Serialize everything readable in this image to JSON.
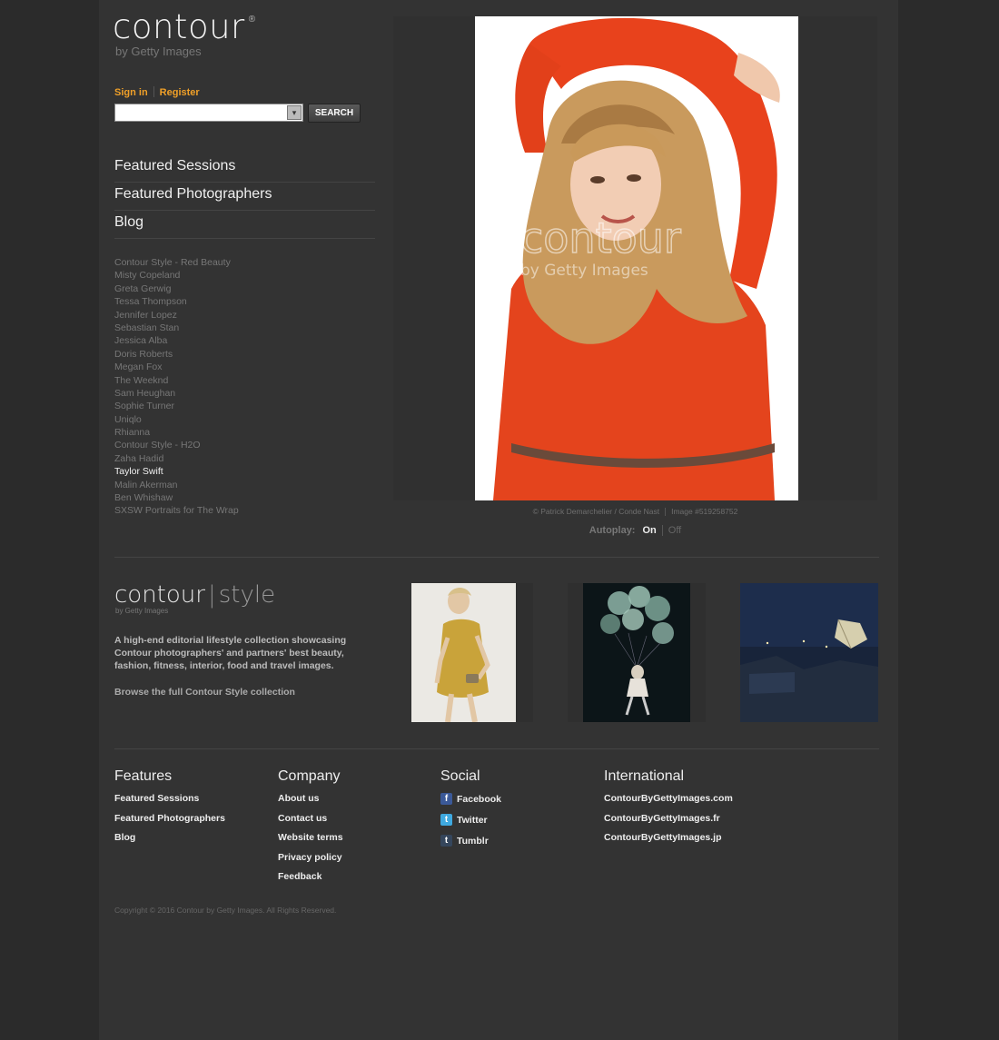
{
  "colors": {
    "accent": "#f0a028",
    "page_bg": "#333333",
    "outer_bg": "#2b2b2b"
  },
  "header": {
    "logo_word": "contour",
    "logo_reg": "®",
    "logo_by": "by Getty Images",
    "sign_in": "Sign in",
    "register": "Register",
    "search_value": "",
    "search_button": "SEARCH"
  },
  "nav": [
    "Featured Sessions",
    "Featured Photographers",
    "Blog"
  ],
  "sessions": [
    "Contour Style - Red Beauty",
    "Misty Copeland",
    "Greta Gerwig",
    "Tessa Thompson",
    "Jennifer Lopez",
    "Sebastian Stan",
    "Jessica Alba",
    "Doris Roberts",
    "Megan Fox",
    "The Weeknd",
    "Sam Heughan",
    "Sophie Turner",
    "Uniqlo",
    "Rhianna",
    "Contour Style - H2O",
    "Zaha Hadid",
    "Taylor Swift",
    "Malin Akerman",
    "Ben Whishaw",
    "SXSW Portraits for The Wrap"
  ],
  "active_session": "Taylor Swift",
  "hero": {
    "watermark_word": "contour",
    "watermark_by": "by Getty Images",
    "credit": "© Patrick Demarchelier / Conde Nast",
    "image_id": "Image #519258752",
    "autoplay_label": "Autoplay:",
    "autoplay_on": "On",
    "autoplay_off": "Off"
  },
  "contour_style": {
    "logo_a": "contour",
    "logo_b": "style",
    "logo_by": "by Getty Images",
    "description": "A high-end editorial lifestyle collection showcasing Contour photographers' and partners' best beauty, fashion, fitness, interior, food and travel images.",
    "browse_link": "Browse the full Contour Style collection"
  },
  "footer": {
    "features": {
      "title": "Features",
      "links": [
        "Featured Sessions",
        "Featured Photographers",
        "Blog"
      ]
    },
    "company": {
      "title": "Company",
      "links": [
        "About us",
        "Contact us",
        "Website terms",
        "Privacy policy",
        "Feedback"
      ]
    },
    "social": {
      "title": "Social",
      "links": [
        "Facebook",
        "Twitter",
        "Tumblr"
      ]
    },
    "international": {
      "title": "International",
      "links": [
        "ContourByGettyImages.com",
        "ContourByGettyImages.fr",
        "ContourByGettyImages.jp"
      ]
    },
    "copyright": "Copyright © 2016 Contour by Getty Images. All Rights Reserved."
  }
}
